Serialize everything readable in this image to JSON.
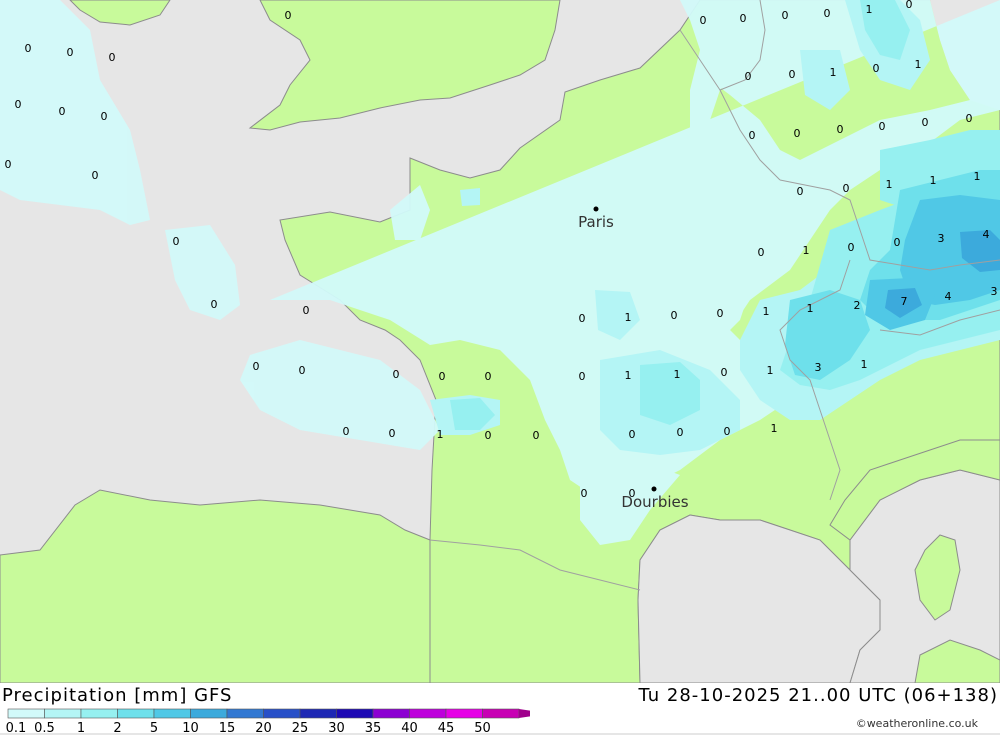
{
  "footer": {
    "title_left": "Precipitation [mm] GFS",
    "title_right": "Tu 28-10-2025 21..00 UTC (06+138)",
    "credit": "©weatheronline.co.uk"
  },
  "legend": {
    "labels": [
      "0.1",
      "0.5",
      "1",
      "2",
      "5",
      "10",
      "15",
      "20",
      "25",
      "30",
      "35",
      "40",
      "45",
      "50"
    ],
    "colors": [
      "#d2fafa",
      "#b4f5f5",
      "#96f0f0",
      "#6ee0eb",
      "#50c8e6",
      "#3caadc",
      "#3278d2",
      "#2850c8",
      "#1e28b4",
      "#1e0ab4",
      "#8c00d2",
      "#be00dc",
      "#e600e6",
      "#c800b4",
      "#a0008c"
    ]
  },
  "colors": {
    "land": "#c8fa9b",
    "sea": "#e6e6e6",
    "border": "#a0a0a0",
    "coast": "#8c8c8c"
  },
  "cities": [
    {
      "name": "Paris"
    },
    {
      "name": "Dourbies"
    }
  ],
  "values": [
    "0",
    "1",
    "2",
    "3",
    "4",
    "7"
  ]
}
